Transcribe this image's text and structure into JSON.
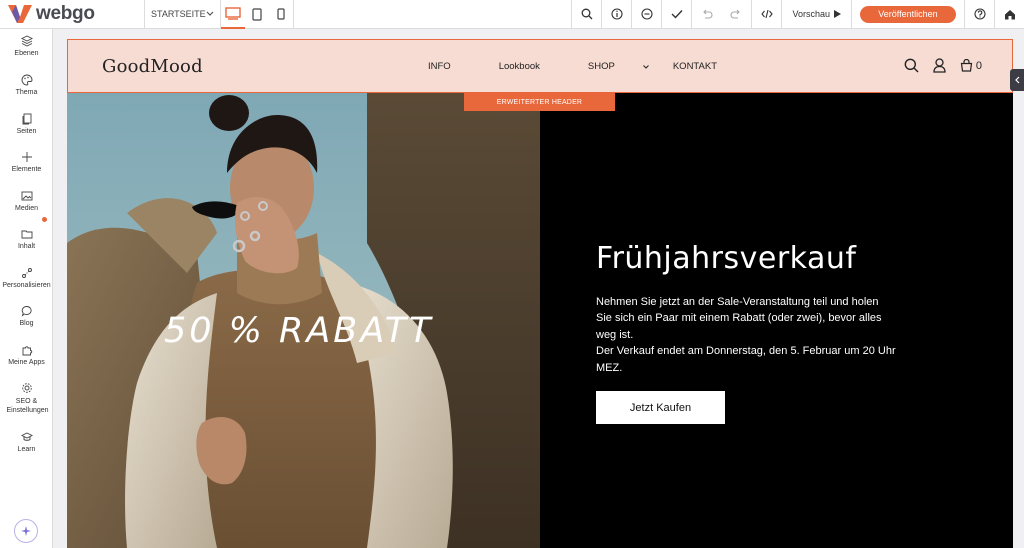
{
  "app": {
    "name": "webgo",
    "page_selector": "STARTSEITE",
    "preview_label": "Vorschau",
    "publish_label": "Veröffentlichen",
    "accent_color": "#e8683c"
  },
  "sidebar": {
    "items": [
      {
        "label": "Ebenen",
        "icon": "layers-icon"
      },
      {
        "label": "Thema",
        "icon": "palette-icon"
      },
      {
        "label": "Seiten",
        "icon": "pages-icon"
      },
      {
        "label": "Elemente",
        "icon": "plus-icon"
      },
      {
        "label": "Medien",
        "icon": "image-icon"
      },
      {
        "label": "Inhalt",
        "icon": "folder-icon"
      },
      {
        "label": "Personalisieren",
        "icon": "personalize-icon"
      },
      {
        "label": "Blog",
        "icon": "chat-icon"
      },
      {
        "label": "Meine Apps",
        "icon": "puzzle-icon"
      },
      {
        "label": "SEO & Einstellungen",
        "icon": "gear-icon"
      },
      {
        "label": "Learn",
        "icon": "graduation-cap-icon"
      }
    ]
  },
  "site": {
    "brand": "GoodMood",
    "nav": [
      {
        "label": "INFO"
      },
      {
        "label": "Lookbook"
      },
      {
        "label": "SHOP"
      },
      {
        "label": "KONTAKT"
      }
    ],
    "cart_count": "0",
    "header_tag": "ERWEITERTER HEADER",
    "hero": {
      "discount": "50 % RABATT",
      "title": "Frühjahrsverkauf",
      "text_line1": "Nehmen Sie jetzt an der Sale-Veranstaltung teil und holen Sie sich ein Paar mit einem Rabatt (oder zwei), bevor alles weg ist.",
      "text_line2": "Der Verkauf endet am Donnerstag, den 5. Februar um 20 Uhr MEZ.",
      "button": "Jetzt Kaufen"
    }
  }
}
